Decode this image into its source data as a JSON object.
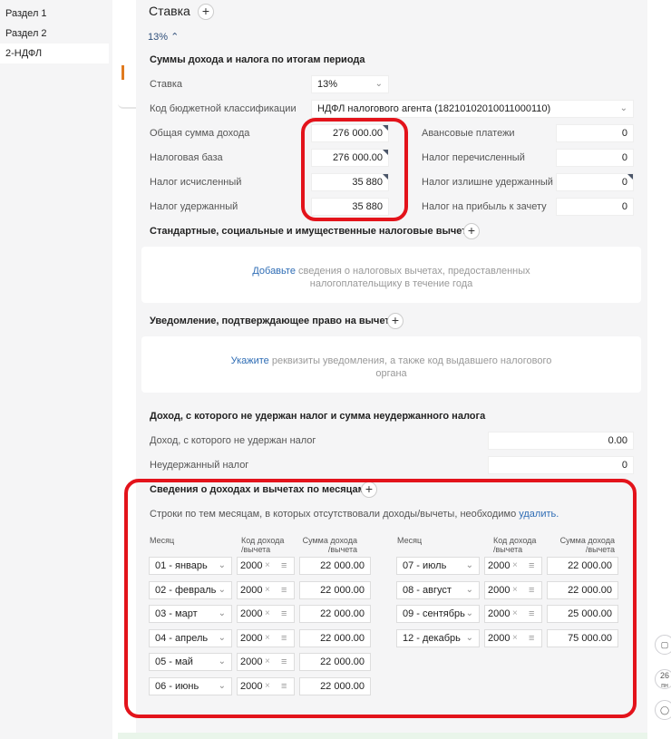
{
  "sidebar": {
    "items": [
      {
        "label": "Раздел 1"
      },
      {
        "label": "Раздел 2"
      },
      {
        "label": "2-НДФЛ"
      }
    ]
  },
  "rate_header": {
    "title": "Ставка",
    "rate_tab": "13%"
  },
  "period": {
    "title": "Суммы дохода и налога по итогам периода",
    "rate_label": "Ставка",
    "rate_value": "13%",
    "kbk_label": "Код бюджетной классификации",
    "kbk_value": "НДФЛ налогового агента (18210102010011000110)",
    "left": [
      {
        "label": "Общая сумма дохода",
        "value": "276 000.00"
      },
      {
        "label": "Налоговая база",
        "value": "276 000.00"
      },
      {
        "label": "Налог исчисленный",
        "value": "35 880"
      },
      {
        "label": "Налог удержанный",
        "value": "35 880"
      }
    ],
    "right": [
      {
        "label": "Авансовые платежи",
        "value": "0"
      },
      {
        "label": "Налог перечисленный",
        "value": "0"
      },
      {
        "label": "Налог излишне удержанный",
        "value": "0"
      },
      {
        "label": "Налог на прибыль к зачету",
        "value": "0"
      }
    ]
  },
  "deductions": {
    "title": "Стандартные, социальные и имущественные налоговые вычеты",
    "link": "Добавьте",
    "text1": " сведения о налоговых вычетах, предоставленных",
    "text2": "налогоплательщику в течение года"
  },
  "notification": {
    "title": "Уведомление, подтверждающее право на вычет",
    "link": "Укажите",
    "text1": " реквизиты уведомления, а также код выдавшего налогового",
    "text2": "органа"
  },
  "unwithheld": {
    "title": "Доход, с которого не удержан налог и сумма неудержанного налога",
    "income_label": "Доход, с которого не удержан налог",
    "income_value": "0.00",
    "tax_label": "Неудержанный налог",
    "tax_value": "0"
  },
  "monthly": {
    "title": "Сведения о доходах и вычетах по месяцам",
    "note": "Строки по тем месяцам, в которых отсутствовали доходы/вычеты, необходимо ",
    "note_link": "удалить.",
    "col_month": "Месяц",
    "col_code_1": "Код дохода",
    "col_code_2": "/вычета",
    "col_sum_1": "Сумма дохода",
    "col_sum_2": "/вычета",
    "left_rows": [
      {
        "month": "01 - январь",
        "code": "2000",
        "sum": "22 000.00"
      },
      {
        "month": "02 - февраль",
        "code": "2000",
        "sum": "22 000.00"
      },
      {
        "month": "03 - март",
        "code": "2000",
        "sum": "22 000.00"
      },
      {
        "month": "04 - апрель",
        "code": "2000",
        "sum": "22 000.00"
      },
      {
        "month": "05 - май",
        "code": "2000",
        "sum": "22 000.00"
      },
      {
        "month": "06 - июнь",
        "code": "2000",
        "sum": "22 000.00"
      }
    ],
    "right_rows": [
      {
        "month": "07 - июль",
        "code": "2000",
        "sum": "22 000.00"
      },
      {
        "month": "08 - август",
        "code": "2000",
        "sum": "22 000.00"
      },
      {
        "month": "09 - сентябрь",
        "code": "2000",
        "sum": "25 000.00"
      },
      {
        "month": "12 - декабрь",
        "code": "2000",
        "sum": "75 000.00"
      }
    ]
  },
  "right_tools": {
    "date_day": "26",
    "date_wd": "пн"
  },
  "colors": {
    "highlight": "#e3131b",
    "link": "#2f6db5"
  }
}
